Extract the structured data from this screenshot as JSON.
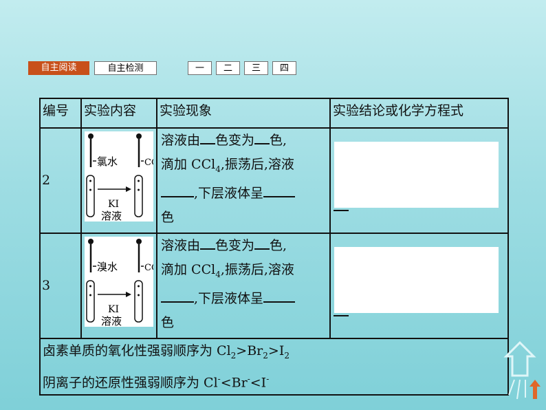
{
  "nav": {
    "tabs": [
      "自主阅读",
      "自主检测"
    ],
    "sections": [
      "一",
      "二",
      "三",
      "四"
    ]
  },
  "table": {
    "headers": [
      "编号",
      "实验内容",
      "实验现象",
      "实验结论或化学方程式"
    ],
    "rows": [
      {
        "id": "2",
        "figure": {
          "reagent": "氯水",
          "solvent": "CC",
          "solution_1": "KI",
          "solution_2": "溶液"
        },
        "obs": {
          "p1": "溶液由",
          "p2": "色变为",
          "p3": "色,",
          "p4": "滴加 CCl",
          "p4sub": "4",
          "p5": ",振荡后,溶液",
          "p6": ",下层液体呈",
          "p7": "色"
        }
      },
      {
        "id": "3",
        "figure": {
          "reagent": "溴水",
          "solvent": "CC",
          "solution_1": "KI",
          "solution_2": "溶液"
        },
        "obs": {
          "p1": "溶液由",
          "p2": "色变为",
          "p3": "色,",
          "p4": "滴加 CCl",
          "p4sub": "4",
          "p5": ",振荡后,溶液",
          "p6": ",下层液体呈",
          "p7": "色"
        }
      }
    ],
    "summary": {
      "line1": {
        "a": "卤素单质的氧化性强弱顺序为 Cl",
        "s1": "2",
        "b": ">Br",
        "s2": "2",
        "c": ">I",
        "s3": "2"
      },
      "line2": {
        "a": "阴离子的还原性强弱顺序为 Cl",
        "s1": "-",
        "b": "<Br",
        "s2": "-",
        "c": "<I",
        "s3": "-"
      }
    }
  },
  "colors": {
    "active_tab": "#c8501a",
    "background": "#9edde3"
  }
}
